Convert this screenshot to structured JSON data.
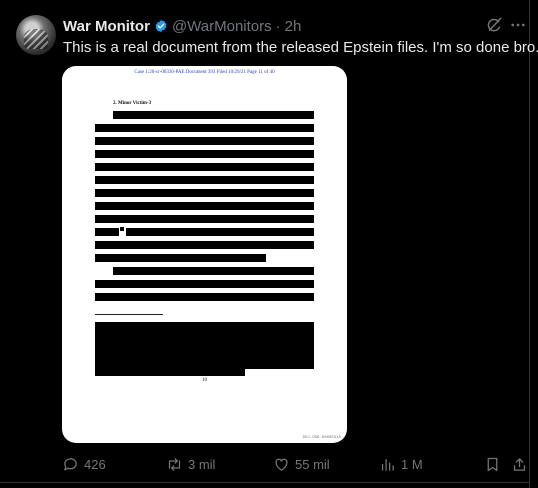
{
  "author": {
    "name": "War Monitor",
    "handle": "@WarMonitors",
    "separator": "·",
    "time": "2h"
  },
  "tweet": {
    "text": "This is a real document from the released Epstein files. I'm so done bro."
  },
  "document": {
    "header_line": "Case 1:20-cr-00330-PAE    Document 393    Filed 10/29/21    Page 11 of 40",
    "section_heading": "2.   Minor Victim-3",
    "page_number": "10",
    "bates": "DOJ-OGR-00005345"
  },
  "actions": {
    "replies": "426",
    "reposts": "3 mil",
    "likes": "55 mil",
    "views": "1 M"
  },
  "colors": {
    "background": "#000000",
    "text_primary": "#e7e9ea",
    "text_secondary": "#71767b",
    "verified_badge": "#1d9bf0",
    "doc_header_blue": "#2b3fb7"
  },
  "icons": [
    "verified-badge-icon",
    "grok-icon",
    "more-icon",
    "reply-icon",
    "repost-icon",
    "like-icon",
    "views-icon",
    "bookmark-icon",
    "share-icon"
  ]
}
